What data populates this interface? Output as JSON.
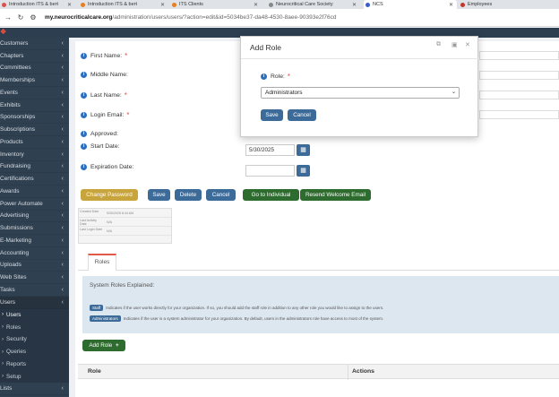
{
  "browser": {
    "tabs": [
      {
        "label": "Introduction ITS & bert",
        "color": "#d9534f"
      },
      {
        "label": "Introduction ITS & bert",
        "color": "#e67e22"
      },
      {
        "label": "ITS Clients",
        "color": "#e67e22"
      },
      {
        "label": "Neurocritical Care Society",
        "color": "#888888"
      },
      {
        "label": "NCS",
        "color": "#3b5dc9"
      },
      {
        "label": "Employees",
        "color": "#c0392b"
      }
    ],
    "url_host": "my.neurocriticalcare.org",
    "url_path": "/administration/users/users/?action=edit&id=5034be37-da48-4530-8aee-90393e2f76cd"
  },
  "sidebar": {
    "items": [
      {
        "label": "Customers"
      },
      {
        "label": "Chapters"
      },
      {
        "label": "Committees"
      },
      {
        "label": "Memberships"
      },
      {
        "label": "Events"
      },
      {
        "label": "Exhibits"
      },
      {
        "label": "Sponsorships"
      },
      {
        "label": "Subscriptions"
      },
      {
        "label": "Products"
      },
      {
        "label": "Inventory"
      },
      {
        "label": "Fundraising"
      },
      {
        "label": "Certifications"
      },
      {
        "label": "Awards"
      },
      {
        "label": "Power Automate"
      },
      {
        "label": "Advertising"
      },
      {
        "label": "Submissions"
      },
      {
        "label": "E-Marketing"
      },
      {
        "label": "Accounting"
      },
      {
        "label": "Uploads"
      },
      {
        "label": "Web Sites"
      },
      {
        "label": "Tasks"
      },
      {
        "label": "Users"
      }
    ],
    "subitems": [
      {
        "label": "Users"
      },
      {
        "label": "Roles"
      },
      {
        "label": "Security"
      },
      {
        "label": "Queries"
      },
      {
        "label": "Reports"
      },
      {
        "label": "Setup"
      }
    ],
    "last": {
      "label": "Lists"
    }
  },
  "form": {
    "first_name_label": "First Name:",
    "middle_name_label": "Middle Name:",
    "last_name_label": "Last Name:",
    "login_email_label": "Login Email:",
    "approved_label": "Approved:",
    "start_date_label": "Start Date:",
    "start_date_value": "5/30/2025",
    "expiration_date_label": "Expiration Date:",
    "expiration_date_value": ""
  },
  "actions": {
    "change_password": "Change Password",
    "save": "Save",
    "delete": "Delete",
    "cancel": "Cancel",
    "go_to_individual": "Go to Individual",
    "resend_welcome": "Resend Welcome Email"
  },
  "info_table": {
    "rows": [
      {
        "key": "Created Date",
        "value": "5/30/2025 8:44 AM"
      },
      {
        "key": "Last Activity Date",
        "value": "N/A"
      },
      {
        "key": "Last Login Date",
        "value": "N/A"
      }
    ]
  },
  "tabs": {
    "roles": "Roles"
  },
  "explain": {
    "title": "System Roles Explained:",
    "staff_badge": "Staff",
    "staff_text": "Indicates if the user works directly for your organization. If so, you should add the staff role in addition to any other role you would like to assign to the users.",
    "admin_badge": "Administrators",
    "admin_text": "Indicates if the user is a system administrator for your organization. By default, users in the administrators role have access to most of the system."
  },
  "add_role_button": "Add Role",
  "grid": {
    "col_role": "Role",
    "col_actions": "Actions"
  },
  "modal": {
    "title": "Add Role",
    "role_label": "Role:",
    "role_value": "Administrators",
    "save": "Save",
    "cancel": "Cancel"
  },
  "colors": {
    "sidebar_bg": "#2f4050",
    "primary_blue": "#3d6b99",
    "green": "#2e6b2e",
    "gold": "#c8a43d",
    "required": "#d9534f"
  }
}
